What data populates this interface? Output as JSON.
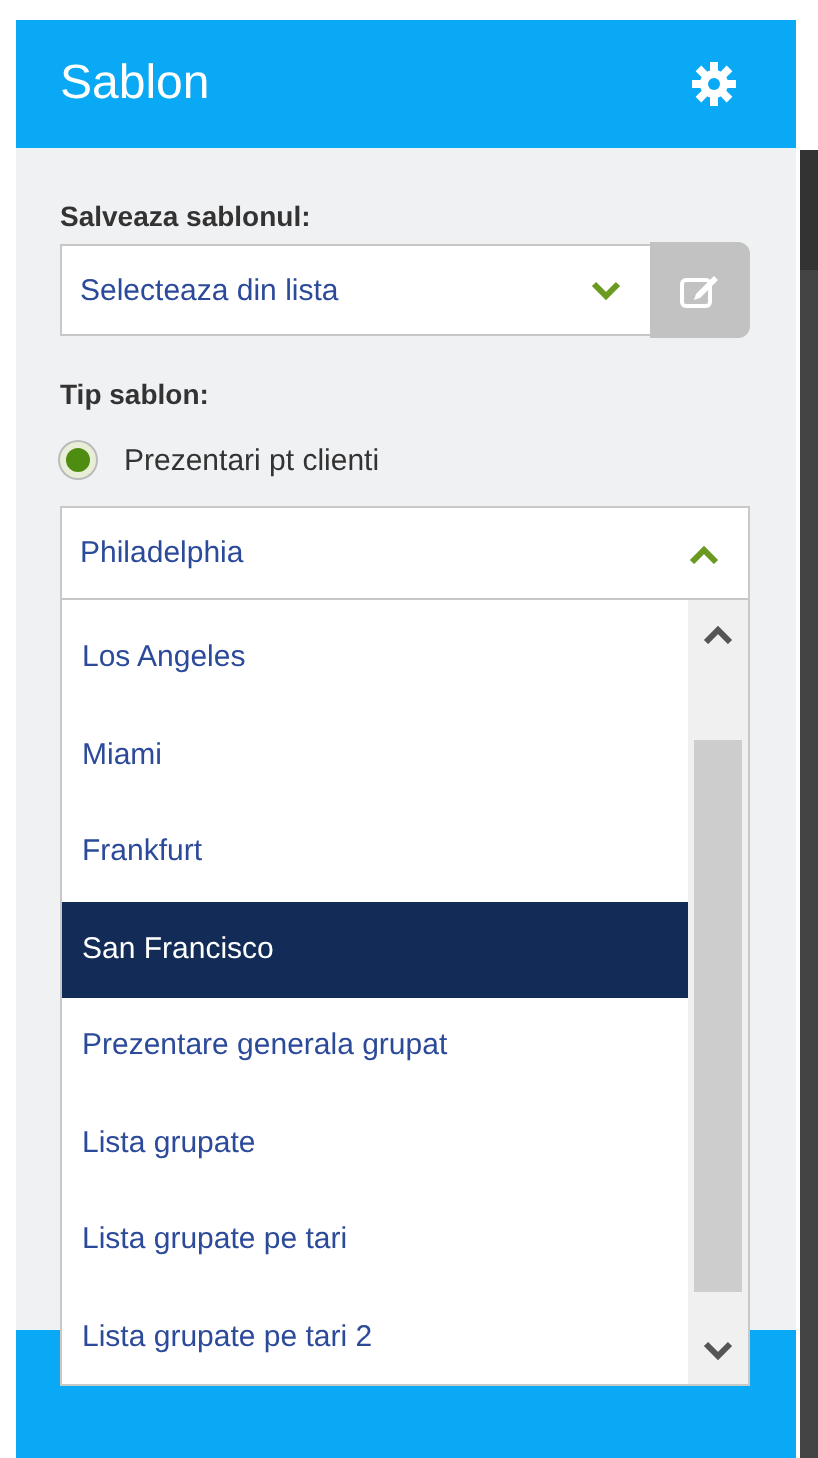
{
  "panel": {
    "title": "Sablon"
  },
  "save_template": {
    "label": "Salveaza sablonul:",
    "select": {
      "value": "Selecteaza din lista",
      "expanded": false
    }
  },
  "template_type": {
    "label": "Tip sablon:",
    "options": [
      {
        "label": "Prezentari pt clienti",
        "selected": true
      }
    ],
    "select": {
      "value": "Philadelphia",
      "expanded": true,
      "items": [
        {
          "label": "Los Angeles",
          "selected": false
        },
        {
          "label": "Miami",
          "selected": false
        },
        {
          "label": "Frankfurt",
          "selected": false
        },
        {
          "label": "San Francisco",
          "selected": true
        },
        {
          "label": "Prezentare generala grupat",
          "selected": false
        },
        {
          "label": "Lista grupate",
          "selected": false
        },
        {
          "label": "Lista grupate pe tari",
          "selected": false
        },
        {
          "label": "Lista grupate pe tari 2",
          "selected": false
        }
      ]
    }
  }
}
